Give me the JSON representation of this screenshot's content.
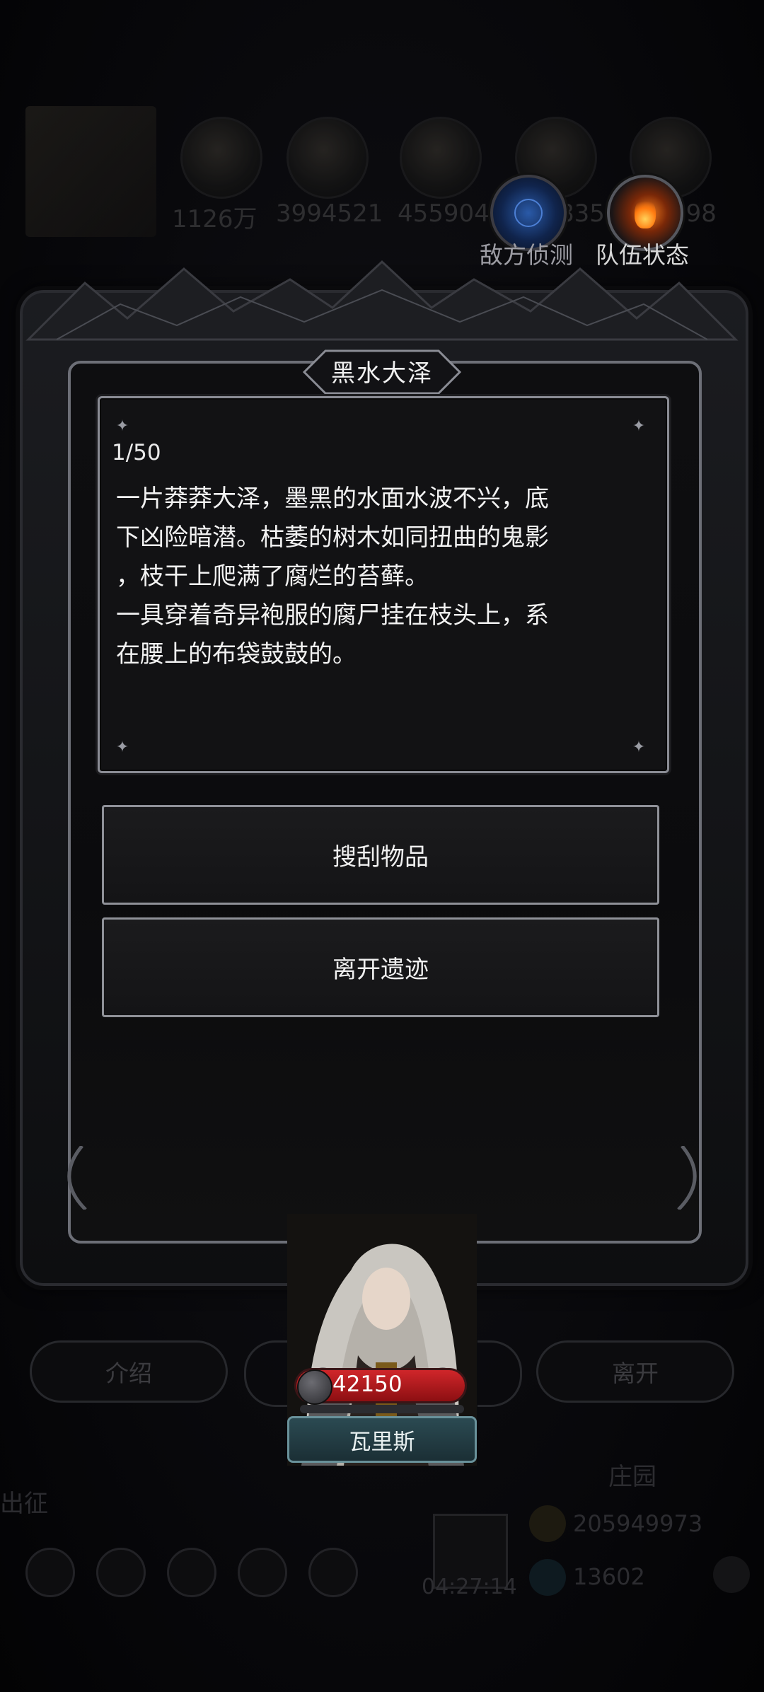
{
  "resources": {
    "values": [
      "1126万",
      "3994521",
      "455904",
      "835",
      "698"
    ]
  },
  "top_buttons": [
    {
      "label": "敌方侦测",
      "icon": "radar-icon"
    },
    {
      "label": "队伍状态",
      "icon": "flame-icon"
    }
  ],
  "dialog": {
    "title": "黑水大泽",
    "page": "1/50",
    "text": "一片莽莽大泽，墨黑的水面水波不兴，底\n下凶险暗潜。枯萎的树木如同扭曲的鬼影\n，枝干上爬满了腐烂的苔藓。\n一具穿着奇异袍服的腐尸挂在枝头上，系\n在腰上的布袋鼓鼓的。",
    "choices": [
      "搜刮物品",
      "离开遗迹"
    ]
  },
  "bottom_buttons": [
    "介绍",
    "离开"
  ],
  "character": {
    "hp": "42150",
    "name": "瓦里斯"
  },
  "background": {
    "label_expedition": "出征",
    "label_manor": "庄园",
    "gold": "205949973",
    "gems": "13602",
    "timer": "04:27:14"
  }
}
